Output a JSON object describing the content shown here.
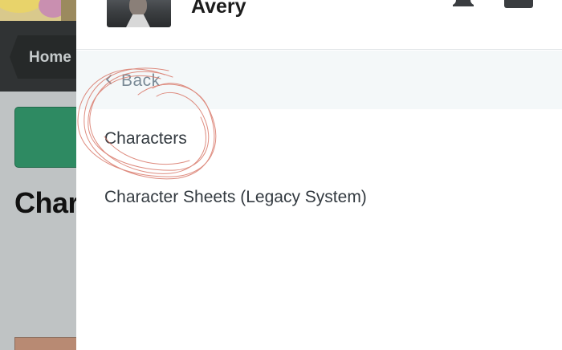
{
  "background": {
    "breadcrumb_label": "Home",
    "heading_text": "Char"
  },
  "drawer": {
    "user_name": "Avery",
    "back_label": "Back",
    "menu_items": [
      {
        "label": "Characters"
      },
      {
        "label": "Character Sheets (Legacy System)"
      }
    ]
  },
  "icons": {
    "notifications": "bell-icon",
    "back": "chevron-left-icon"
  },
  "colors": {
    "accent_green": "#2e8a62",
    "annotation_red": "#d9796a",
    "back_row_bg": "#f4f8f9",
    "muted_text": "#7a8a96"
  }
}
